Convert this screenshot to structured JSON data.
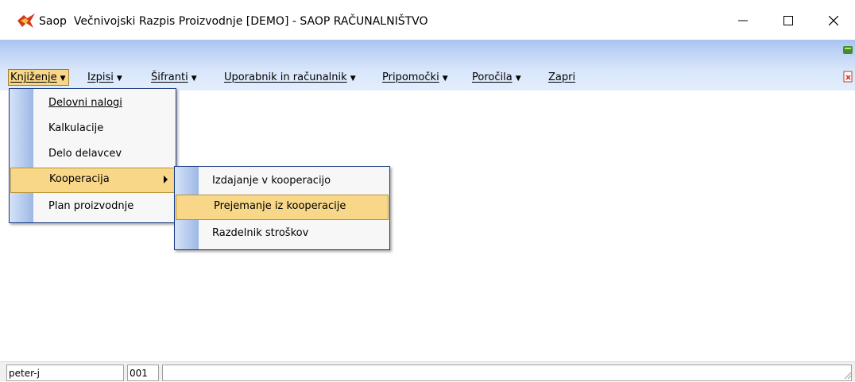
{
  "window": {
    "app_name": "Saop",
    "title": "Večnivojski Razpis Proizvodnje [DEMO] - SAOP RAČUNALNIŠTVO",
    "minimize_glyph": "—",
    "maximize_glyph": "☐",
    "close_glyph": "✕"
  },
  "menubar": {
    "items": [
      {
        "label": "Knjiženje",
        "arrow": "▼"
      },
      {
        "label": "Izpisi",
        "arrow": "▼"
      },
      {
        "label": "Šifranti",
        "arrow": "▼"
      },
      {
        "label": "Uporabnik in računalnik",
        "arrow": "▼"
      },
      {
        "label": "Pripomočki",
        "arrow": "▼"
      },
      {
        "label": "Poročila",
        "arrow": "▼"
      },
      {
        "label": "Zapri",
        "arrow": ""
      }
    ]
  },
  "dropdown": {
    "items": [
      {
        "label": "Delovni nalogi"
      },
      {
        "label": "Kalkulacije"
      },
      {
        "label": "Delo delavcev"
      },
      {
        "label": "Kooperacija"
      },
      {
        "label": "Plan proizvodnje"
      }
    ]
  },
  "submenu": {
    "items": [
      {
        "label": "Izdajanje v kooperacijo"
      },
      {
        "label": "Prejemanje iz kooperacije"
      },
      {
        "label": "Razdelnik stroškov"
      }
    ]
  },
  "statusbar": {
    "user": "peter-j",
    "code": "001",
    "message": ""
  },
  "icons": {
    "app": "saop-bird-logo-icon",
    "tray_top": "green-book-icon",
    "tray_bottom": "red-document-close-icon"
  },
  "colors": {
    "selection": "#f8d789",
    "menu_border": "#1a3b7e",
    "band_top": "#a9c4f1",
    "band_bottom": "#e3edfd"
  }
}
